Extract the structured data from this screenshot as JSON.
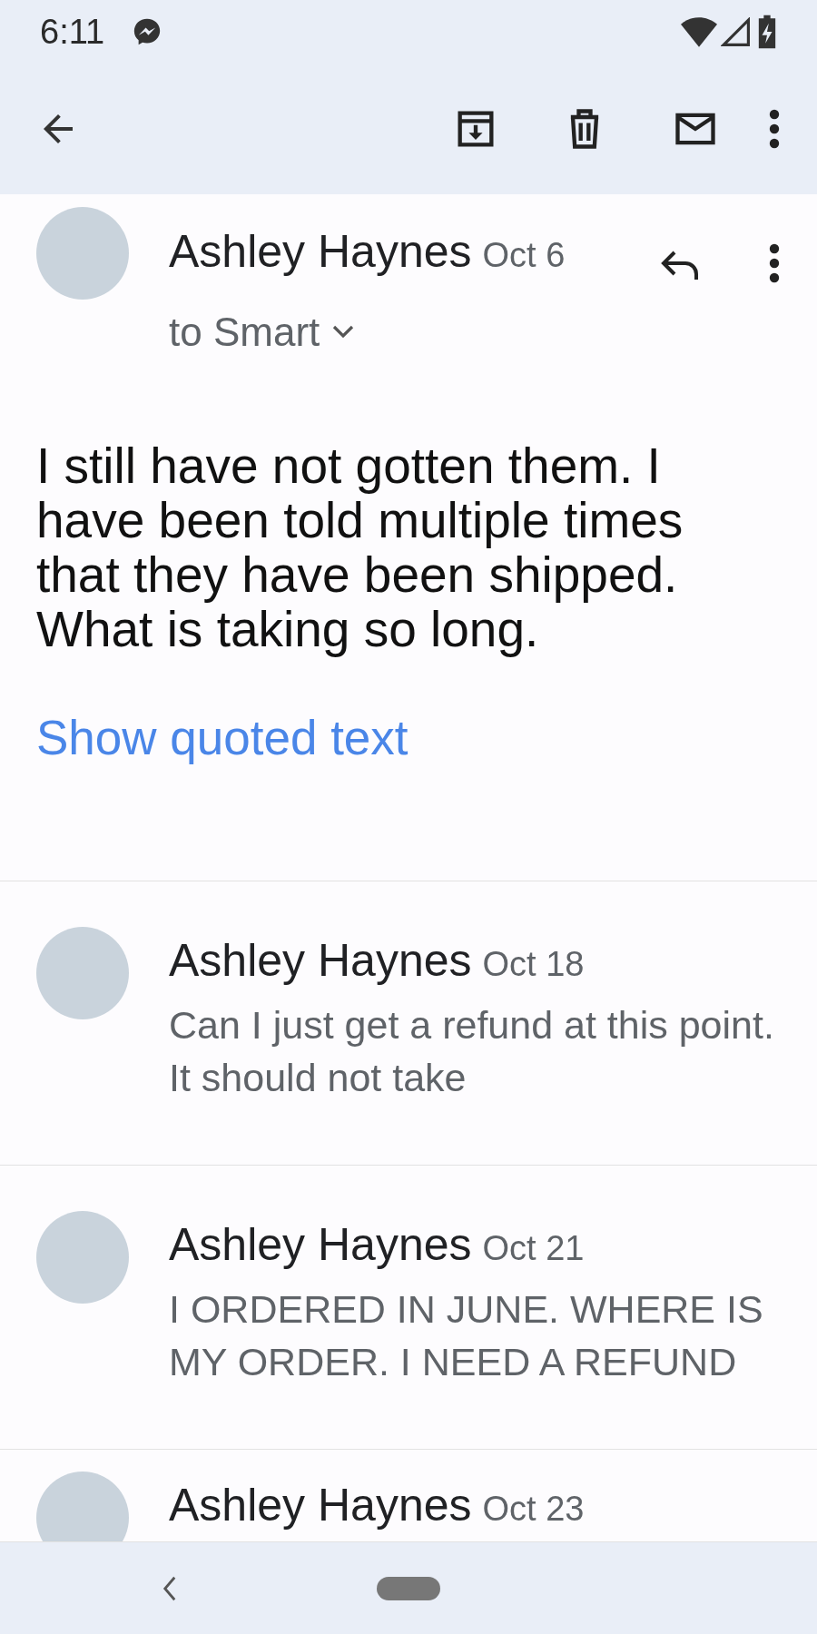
{
  "status_bar": {
    "time": "6:11"
  },
  "first_message": {
    "sender": "Ashley Haynes",
    "date": "Oct 6",
    "recipient": "to Smart",
    "body": "I still have not gotten them. I have been told multiple times that they have been shipped. What is taking so long.",
    "quoted_link": "Show quoted text"
  },
  "messages": [
    {
      "sender": "Ashley Haynes",
      "date": "Oct 18",
      "snippet": "Can I just get a refund at this point. It should not take"
    },
    {
      "sender": "Ashley Haynes",
      "date": "Oct 21",
      "snippet": "I ORDERED IN JUNE. WHERE IS MY ORDER. I NEED A REFUND"
    },
    {
      "sender": "Ashley Haynes",
      "date": "Oct 23"
    }
  ]
}
